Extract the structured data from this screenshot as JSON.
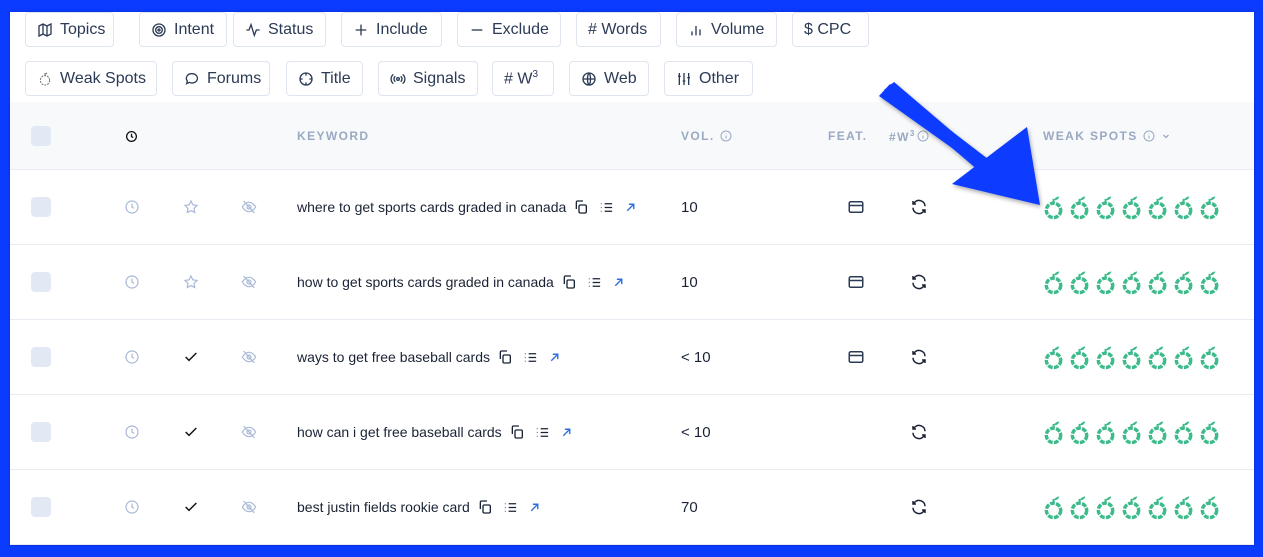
{
  "filters": {
    "row1": [
      {
        "label": "Topics",
        "icon": "map-icon"
      },
      {
        "label": "Intent",
        "icon": "target-icon"
      },
      {
        "label": "Status",
        "icon": "activity-icon"
      },
      {
        "label": "Include",
        "icon": "plus-icon"
      },
      {
        "label": "Exclude",
        "icon": "minus-icon"
      },
      {
        "label": "# Words",
        "icon": ""
      },
      {
        "label": "Volume",
        "icon": "bar-chart-icon"
      },
      {
        "label": "$ CPC",
        "icon": ""
      }
    ],
    "row2": [
      {
        "label": "Weak Spots",
        "icon": "apple-icon"
      },
      {
        "label": "Forums",
        "icon": "chat-bubble-icon"
      },
      {
        "label": "Title",
        "icon": "crosshair-icon"
      },
      {
        "label": "Signals",
        "icon": "broadcast-icon"
      },
      {
        "label": "# W",
        "sup": "3",
        "icon": ""
      },
      {
        "label": "Web",
        "icon": "globe-icon"
      },
      {
        "label": "Other",
        "icon": "sliders-icon"
      }
    ]
  },
  "table": {
    "headers": {
      "keyword": "KEYWORD",
      "volume": "VOL.",
      "features": "FEAT.",
      "w3": "#W",
      "w3_sup": "3",
      "weak_spots": "WEAK SPOTS"
    },
    "rows": [
      {
        "keyword": "where to get sports cards graded in canada",
        "status": "star",
        "volume": "10",
        "has_feature": true,
        "weak_spots": 7
      },
      {
        "keyword": "how to get sports cards graded in canada",
        "status": "star",
        "volume": "10",
        "has_feature": true,
        "weak_spots": 7
      },
      {
        "keyword": "ways to get free baseball cards",
        "status": "check",
        "volume": "< 10",
        "has_feature": true,
        "weak_spots": 7
      },
      {
        "keyword": "how can i get free baseball cards",
        "status": "check",
        "volume": "< 10",
        "has_feature": false,
        "weak_spots": 7
      },
      {
        "keyword": "best justin fields rookie card",
        "status": "check",
        "volume": "70",
        "has_feature": false,
        "weak_spots": 7
      }
    ]
  },
  "colors": {
    "frame_border": "#0b3bff",
    "annotation_arrow": "#0b3bff",
    "weak_spot_green": "#3dbb8a",
    "header_text": "#9aa9c2",
    "body_text": "#1a2335",
    "link_blue": "#2f6fe0",
    "muted_icon": "#a9b9d6"
  }
}
